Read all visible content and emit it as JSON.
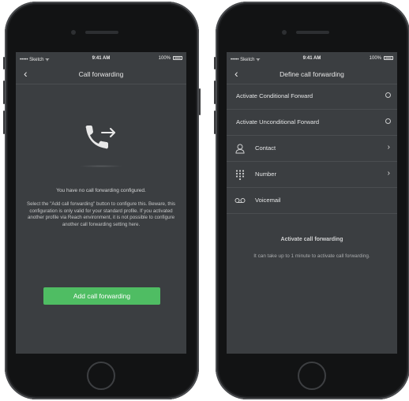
{
  "status_bar": {
    "carrier": "••••• Sketch ᯤ",
    "time": "9:41 AM",
    "battery": "100%"
  },
  "left": {
    "nav": {
      "back_glyph": "‹",
      "title": "Call forwarding"
    },
    "icon": "phone-forward-icon",
    "message": "You have no call forwarding configured.",
    "description": "Select the \"Add call forwarding\" button to configure this. Beware, this configuration is only valid for your standard profile. If you activated another profile via Reach environment, it is not possible to configure another call forwarding setting here.",
    "button_label": "Add call forwarding",
    "accent_color": "#4fbd63"
  },
  "right": {
    "nav": {
      "back_glyph": "‹",
      "title": "Define call forwarding"
    },
    "options": [
      {
        "label": "Activate Conditional Forward",
        "control": "radio"
      },
      {
        "label": "Activate Unconditional Forward",
        "control": "radio"
      },
      {
        "label": "Contact",
        "icon": "person-icon",
        "control": "chevron"
      },
      {
        "label": "Number",
        "icon": "keypad-icon",
        "control": "chevron"
      },
      {
        "label": "Voicemail",
        "icon": "voicemail-icon",
        "control": "none"
      }
    ],
    "chevron_glyph": "›",
    "section_title": "Activate call forwarding",
    "section_subtitle": "It can take up to 1 minute to activate call forwarding."
  }
}
